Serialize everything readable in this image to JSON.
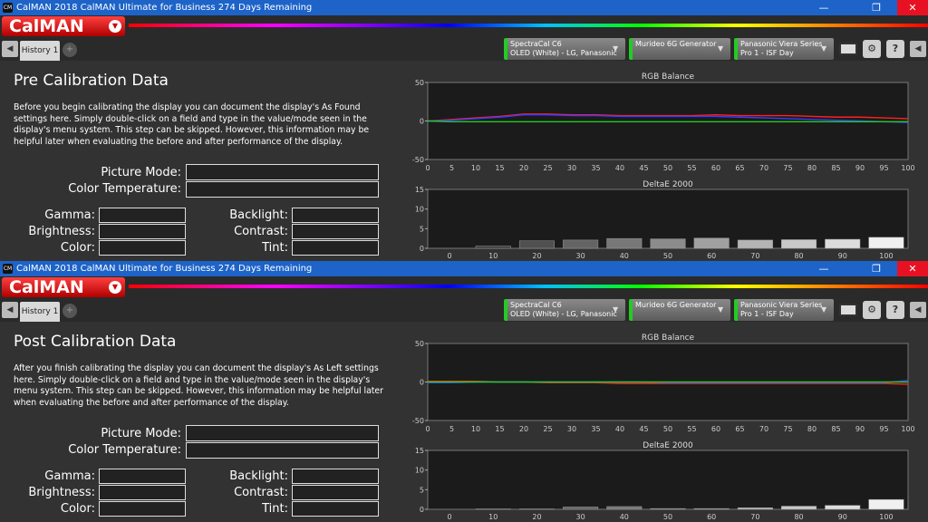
{
  "window_title": "CalMAN 2018 CalMAN Ultimate for Business 274 Days Remaining",
  "app_icon_label": "CM",
  "logo_text": "CalMAN",
  "tab_label": "History 1",
  "devices": [
    {
      "line1": "SpectraCal C6",
      "line2": "OLED (White) - LG, Panasonic"
    },
    {
      "line1": "Murideo 6G Generator",
      "line2": ""
    },
    {
      "line1": "Panasonic Viera Series",
      "line2": "Pro 1 - ISF Day"
    }
  ],
  "fields": {
    "picture_mode": "Picture Mode:",
    "color_temperature": "Color Temperature:",
    "gamma": "Gamma:",
    "brightness": "Brightness:",
    "color": "Color:",
    "backlight": "Backlight:",
    "contrast": "Contrast:",
    "tint": "Tint:"
  },
  "pre": {
    "title": "Pre Calibration Data",
    "description": "Before you begin calibrating the display you can document the display's As Found settings here. Simply double-click on a field and type in the value/mode seen in the display's menu system. This step can be skipped. However, this information may be helpful later when evaluating the before and after performance of the display."
  },
  "post": {
    "title": "Post Calibration Data",
    "description": "After you finish calibrating the display you can document the display's As Left settings here. Simply double-click on a field and type in the value/mode seen in the display's menu system. This step can be skipped. However, this information may be helpful later when evaluating the before and after performance of the display."
  },
  "colors": {
    "red": "#ff2020",
    "blue": "#3a3aff",
    "green": "#22cc22",
    "accent": "#1d63c8"
  },
  "chart_data": [
    {
      "type": "line",
      "title": "RGB Balance",
      "panel": "pre",
      "x": [
        0,
        5,
        10,
        15,
        20,
        25,
        30,
        35,
        40,
        45,
        50,
        55,
        60,
        65,
        70,
        75,
        80,
        85,
        90,
        95,
        100
      ],
      "ylim": [
        -50,
        50
      ],
      "yticks": [
        -50,
        0,
        50
      ],
      "series": [
        {
          "color": "#ff2020",
          "values": [
            0,
            2,
            4,
            6,
            9,
            9,
            8,
            8,
            7,
            7,
            7,
            7,
            8,
            7,
            7,
            7,
            6,
            5,
            5,
            4,
            3
          ]
        },
        {
          "color": "#3a3aff",
          "values": [
            0,
            1,
            3,
            5,
            8,
            8,
            7,
            7,
            6,
            6,
            6,
            6,
            6,
            5,
            4,
            3,
            2,
            1,
            0,
            -1,
            -2
          ]
        },
        {
          "color": "#22cc22",
          "values": [
            0,
            -1,
            -1,
            -1,
            -1,
            -1,
            -1,
            -1,
            -1,
            -1,
            -1,
            -1,
            -1,
            -1,
            -1,
            -1,
            -1,
            -1,
            -1,
            -1,
            -1
          ]
        }
      ]
    },
    {
      "type": "bar",
      "title": "DeltaE 2000",
      "panel": "pre",
      "categories": [
        "0",
        "10",
        "20",
        "30",
        "40",
        "50",
        "60",
        "70",
        "80",
        "90",
        "100"
      ],
      "values": [
        0,
        0.6,
        1.9,
        2.1,
        2.5,
        2.4,
        2.6,
        2.1,
        2.2,
        2.3,
        2.8
      ],
      "ylim": [
        0,
        15
      ],
      "yticks": [
        0,
        5,
        10,
        15
      ]
    },
    {
      "type": "line",
      "title": "RGB Balance",
      "panel": "post",
      "x": [
        0,
        5,
        10,
        15,
        20,
        25,
        30,
        35,
        40,
        45,
        50,
        55,
        60,
        65,
        70,
        75,
        80,
        85,
        90,
        95,
        100
      ],
      "ylim": [
        -50,
        50
      ],
      "yticks": [
        -50,
        0,
        50
      ],
      "series": [
        {
          "color": "#ff2020",
          "values": [
            1,
            1,
            1,
            0,
            0,
            -1,
            -1,
            -1,
            -2,
            -2,
            -2,
            -2,
            -2,
            -2,
            -2,
            -2,
            -2,
            -2,
            -2,
            -2,
            -3
          ]
        },
        {
          "color": "#3a3aff",
          "values": [
            -1,
            -1,
            0,
            0,
            0,
            0,
            0,
            0,
            0,
            0,
            -1,
            -1,
            -1,
            -1,
            -1,
            -1,
            -1,
            -1,
            -1,
            -1,
            2
          ]
        },
        {
          "color": "#22cc22",
          "values": [
            0,
            0,
            0,
            0,
            0,
            0,
            0,
            0,
            0,
            0,
            0,
            0,
            0,
            0,
            0,
            0,
            0,
            0,
            0,
            0,
            0
          ]
        }
      ]
    },
    {
      "type": "bar",
      "title": "DeltaE 2000",
      "panel": "post",
      "categories": [
        "0",
        "10",
        "20",
        "30",
        "40",
        "50",
        "60",
        "70",
        "80",
        "90",
        "100"
      ],
      "values": [
        0,
        0.1,
        0.1,
        0.6,
        0.7,
        0.2,
        0.2,
        0.4,
        0.8,
        1.0,
        2.5
      ],
      "ylim": [
        0,
        15
      ],
      "yticks": [
        0,
        5,
        10,
        15
      ]
    }
  ]
}
